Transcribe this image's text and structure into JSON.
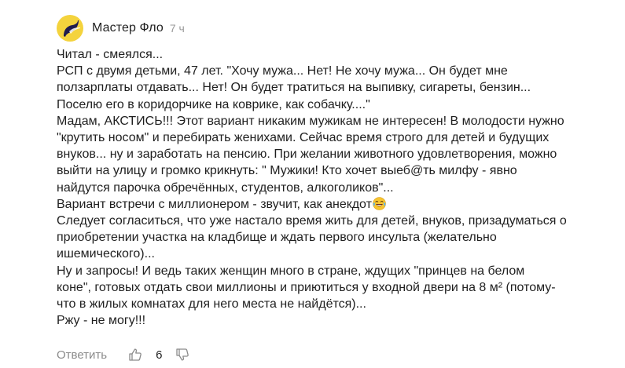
{
  "comment": {
    "author": "Мастер Фло",
    "time": "7 ч",
    "avatar_icon": "avatar-icon",
    "lines": [
      "Читал - смеялся...",
      "РСП с двумя детьми, 47 лет. \"Хочу мужа... Нет! Не хочу мужа... Он будет мне",
      "ползарплаты отдавать... Нет! Он будет тратиться на выпивку, сигареты, бензин...",
      "Поселю его в коридорчике на коврике, как собачку....\"",
      "Мадам, АКСТИСЬ!!! Этот вариант никаким мужикам не интересен! В молодости нужно",
      "\"крутить носом\" и перебирать женихами. Сейчас время строго для детей и будущих",
      "внуков... ну и заработать на пенсию. При желании животного удовлетворения, можно",
      "выйти на улицу и громко крикнуть: \" Мужики! Кто хочет выеб@ть милфу - явно",
      "найдутся парочка обречённых, студентов, алкоголиков\"...",
      "Вариант встречи с миллионером - звучит, как анекдот",
      "Следует согласиться, что уже настало время жить для детей, внуков, призадуматься о",
      "приобретении участка на кладбище и ждать первого инсульта (желательно",
      "ишемического)...",
      "Ну и запросы! И ведь таких женщин много в стране, ждущих \"принцев на белом",
      "коне\", готовых отдать свои миллионы и приютиться у входной двери на 8 м² (потому-",
      "что в жилых комнатах для него места не найдётся)...",
      "Ржу - не могу!!!"
    ],
    "emoji": "laughing-crying-emoji"
  },
  "actions": {
    "reply_label": "Ответить",
    "like_icon": "thumbs-up-icon",
    "like_count": "6",
    "dislike_icon": "thumbs-down-icon"
  },
  "colors": {
    "avatar_bg": "#f4d33d",
    "avatar_shape": "#1f1b4e",
    "text": "#1f1f1f",
    "muted": "#9a9a9a"
  }
}
